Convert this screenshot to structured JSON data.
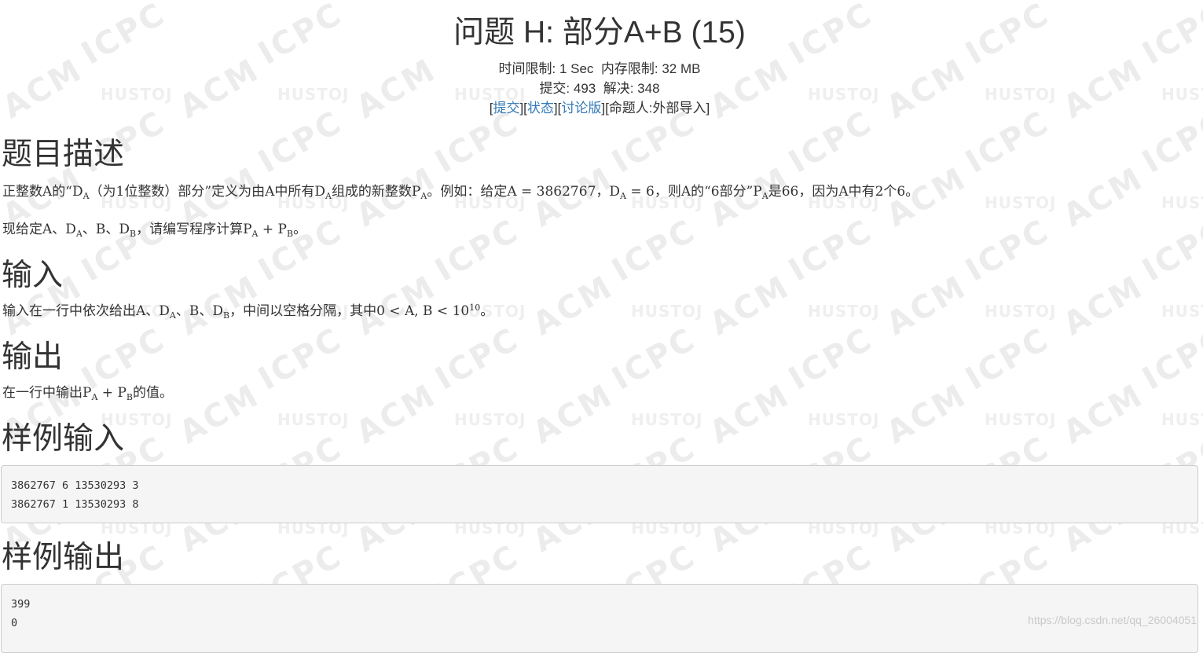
{
  "problem": {
    "title": "问题 H: 部分A+B (15)",
    "time_limit_label": "时间限制: ",
    "time_limit_value": "1 Sec",
    "memory_limit_label": "内存限制: ",
    "memory_limit_value": "32 MB",
    "submit_count_label": "提交: ",
    "submit_count_value": "493",
    "solved_count_label": "解决: ",
    "solved_count_value": "348",
    "links": {
      "submit": "提交",
      "status": "状态",
      "discuss": "讨论版",
      "author": "命题人:外部导入"
    }
  },
  "sections": {
    "description_heading": "题目描述",
    "description_line1": {
      "p1": "正整数A的“D",
      "s1": "A",
      "p2": "（为1位整数）部分”定义为由A中所有D",
      "s2": "A",
      "p3": "组成的新整数P",
      "s3": "A",
      "p4": "。例如：给定A = 3862767，D",
      "s4": "A",
      "p5": " = 6，则A的“6部分”P",
      "s5": "A",
      "p6": "是66，因为A中有2个6。"
    },
    "description_line2": {
      "p1": "现给定A、D",
      "s1": "A",
      "p2": "、B、D",
      "s2": "B",
      "p3": "，请编写程序计算P",
      "s3": "A",
      "p4": " + P",
      "s4": "B",
      "p5": "。"
    },
    "input_heading": "输入",
    "input_text": {
      "p1": "输入在一行中依次给出A、D",
      "s1": "A",
      "p2": "、B、D",
      "s2": "B",
      "p3": "，中间以空格分隔，其中0 < A, B < 10",
      "sup1": "10",
      "p4": "。"
    },
    "output_heading": "输出",
    "output_text": {
      "p1": "在一行中输出P",
      "s1": "A",
      "p2": " + P",
      "s2": "B",
      "p3": "的值。"
    },
    "sample_input_heading": "样例输入",
    "sample_input": "3862767 6 13530293 3\n3862767 1 13530293 8",
    "sample_output_heading": "样例输出",
    "sample_output": "399\n0"
  },
  "watermark": {
    "acm": "ACM",
    "icpc": "ICPC",
    "hustoj": "HUSTOJ",
    "credit": "https://blog.csdn.net/qq_26004051"
  }
}
